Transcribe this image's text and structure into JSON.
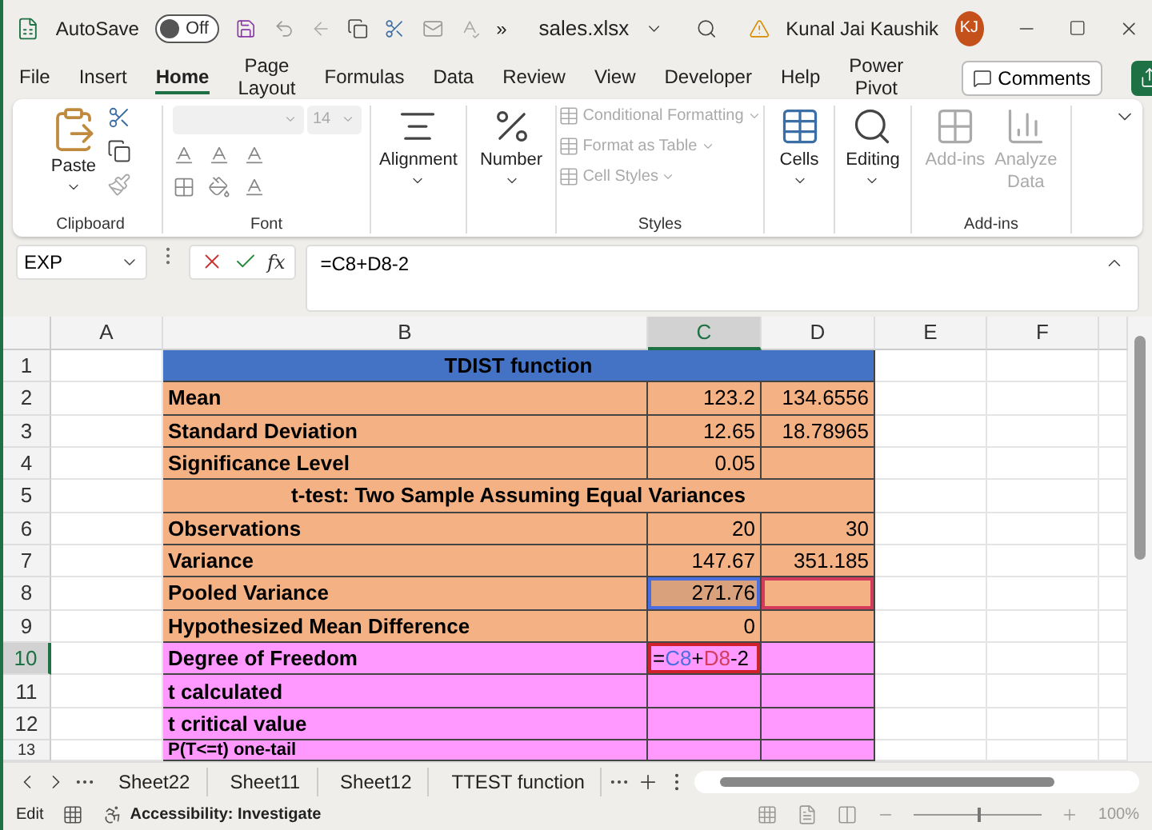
{
  "titlebar": {
    "autosave_label": "AutoSave",
    "autosave": {
      "on": false,
      "label": "Off"
    },
    "more": "»",
    "filename": "sales.xlsx",
    "user": "Kunal Jai Kaushik",
    "avatar": "KJ"
  },
  "menu": [
    {
      "label": "File",
      "selected": false
    },
    {
      "label": "Insert",
      "selected": false
    },
    {
      "label": "Home",
      "selected": true
    },
    {
      "label": "Page Layout",
      "selected": false
    },
    {
      "label": "Formulas",
      "selected": false
    },
    {
      "label": "Data",
      "selected": false
    },
    {
      "label": "Review",
      "selected": false
    },
    {
      "label": "View",
      "selected": false
    },
    {
      "label": "Developer",
      "selected": false
    },
    {
      "label": "Help",
      "selected": false
    },
    {
      "label": "Power Pivot",
      "selected": false
    }
  ],
  "comments_button": "Comments",
  "ribbon": {
    "paste": "Paste",
    "clipboard": "Clipboard",
    "font_size": "14",
    "font": "Font",
    "alignment": "Alignment",
    "number": "Number",
    "styles_items": [
      "Conditional Formatting",
      "Format as Table",
      "Cell Styles"
    ],
    "styles": "Styles",
    "cells": "Cells",
    "editing": "Editing",
    "addins_button": "Add-ins",
    "analyze": [
      "Analyze",
      "Data"
    ],
    "addins": "Add-ins"
  },
  "formula_bar": {
    "name_box": "EXP",
    "fx": "fx",
    "formula": "=C8+D8-2"
  },
  "columns": [
    {
      "label": "A",
      "selected": false
    },
    {
      "label": "B",
      "selected": false
    },
    {
      "label": "C",
      "selected": true
    },
    {
      "label": "D",
      "selected": false
    },
    {
      "label": "E",
      "selected": false
    },
    {
      "label": "F",
      "selected": false
    }
  ],
  "rows": [
    {
      "number": "1",
      "kind": "title",
      "color": "#4472c4",
      "label": "TDIST function"
    },
    {
      "number": "2",
      "kind": "data",
      "color": "#f4b183",
      "label": "Mean",
      "c": "123.2",
      "d": "134.6556"
    },
    {
      "number": "3",
      "kind": "data",
      "color": "#f4b183",
      "label": "Standard Deviation",
      "c": "12.65",
      "d": "18.78965"
    },
    {
      "number": "4",
      "kind": "data",
      "color": "#f4b183",
      "label": "Significance Level",
      "c": "0.05"
    },
    {
      "number": "5",
      "kind": "title",
      "color": "#f4b183",
      "label": "t-test: Two Sample Assuming Equal Variances"
    },
    {
      "number": "6",
      "kind": "data",
      "color": "#f4b183",
      "label": "Observations",
      "c": "20",
      "d": "30"
    },
    {
      "number": "7",
      "kind": "data",
      "color": "#f4b183",
      "label": "Variance",
      "c": "147.67",
      "d": "351.185"
    },
    {
      "number": "8",
      "kind": "data",
      "color": "#f4b183",
      "label": "Pooled Variance",
      "c": "271.76",
      "c_ref": true,
      "d_ref": true
    },
    {
      "number": "9",
      "kind": "data",
      "color": "#f4b183",
      "label": "Hypothesized Mean Difference",
      "c": "0"
    },
    {
      "number": "10",
      "kind": "edit",
      "color": "#ff99ff",
      "label": "Degree of Freedom",
      "selected": true,
      "formula_parts": [
        {
          "text": "=",
          "kind": "plain"
        },
        {
          "text": "C8",
          "kind": "ref"
        },
        {
          "text": "+",
          "kind": "plain"
        },
        {
          "text": "D8",
          "kind": "ref"
        },
        {
          "text": "-2",
          "kind": "plain"
        }
      ]
    },
    {
      "number": "11",
      "kind": "data",
      "color": "#ff99ff",
      "label": "t calculated"
    },
    {
      "number": "12",
      "kind": "data",
      "color": "#ff99ff",
      "label": "t critical value"
    },
    {
      "number": "13",
      "kind": "partial",
      "color": "#ff99ff",
      "label": "P(T<=t) one-tail"
    }
  ],
  "sheets": [
    {
      "label": "Sheet22",
      "selected": false
    },
    {
      "label": "Sheet11",
      "selected": false
    },
    {
      "label": "Sheet12",
      "selected": false
    },
    {
      "label": "TTEST function",
      "selected": false
    }
  ],
  "status": {
    "mode": "Edit",
    "accessibility": "Accessibility: Investigate",
    "zoom_slider": {
      "level": 0.5
    },
    "zoom": "100%"
  }
}
